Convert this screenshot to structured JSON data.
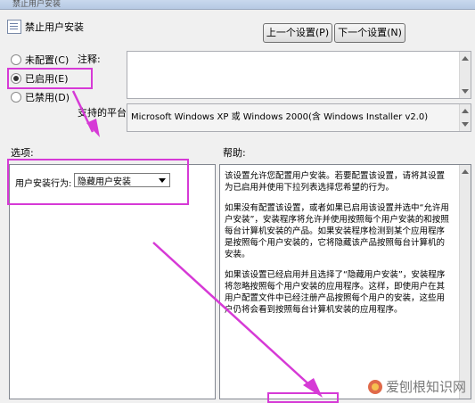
{
  "window": {
    "title_fragment": "禁止用户安装"
  },
  "header": {
    "policy_name": "禁止用户安装",
    "prev_button": "上一个设置(P)",
    "next_button": "下一个设置(N)"
  },
  "state": {
    "options": [
      {
        "label": "未配置(C)",
        "checked": false
      },
      {
        "label": "已启用(E)",
        "checked": true
      },
      {
        "label": "已禁用(D)",
        "checked": false
      }
    ]
  },
  "comment": {
    "label": "注释:",
    "value": ""
  },
  "supported": {
    "label": "支持的平台:",
    "value": "Microsoft Windows XP 或 Windows 2000(含 Windows Installer v2.0)"
  },
  "sections": {
    "options_label": "选项:",
    "help_label": "帮助:"
  },
  "options_panel": {
    "field_label": "用户安装行为:",
    "selected": "隐藏用户安装"
  },
  "help": {
    "paragraphs": [
      "该设置允许您配置用户安装。若要配置该设置，请将其设置为已启用并使用下拉列表选择您希望的行为。",
      "如果没有配置该设置，或者如果已启用该设置并选中“允许用户安装”，安装程序将允许并使用按照每个用户安装的和按照每台计算机安装的产品。如果安装程序检测到某个应用程序是按照每个用户安装的，它将隐藏该产品按照每台计算机的安装。",
      "如果该设置已经启用并且选择了“隐藏用户安装”，安装程序将忽略按照每个用户安装的应用程序。这样，即使用户在其用户配置文件中已经注册产品按照每个用户的安装，这些用户仍将会看到按照每台计算机安装的应用程序。"
    ]
  },
  "watermark": {
    "text": "爱刨根知识网"
  },
  "colors": {
    "annotation": "#d63ad6",
    "window_bg": "#f0f0f0"
  }
}
